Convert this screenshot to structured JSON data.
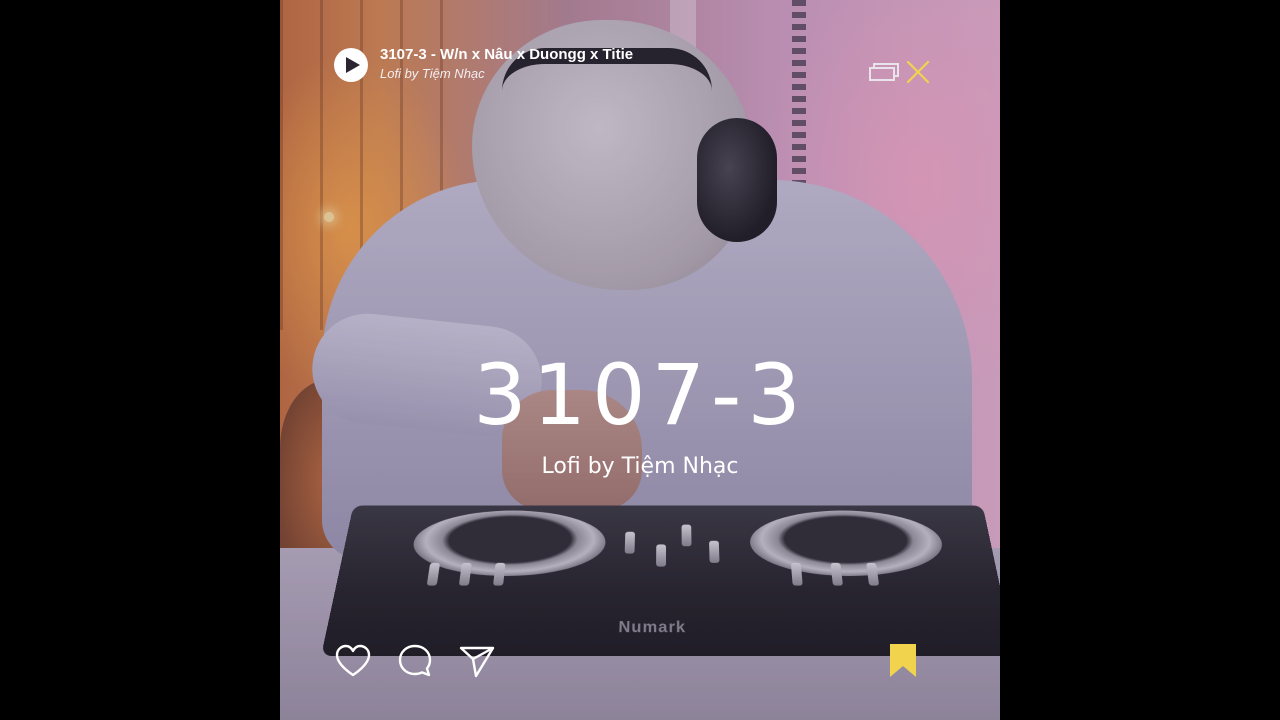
{
  "player": {
    "song_title": "3107-3 - W/n x Nâu x Duongg x Titie",
    "song_subtitle": "Lofi by Tiệm Nhạc"
  },
  "artwork": {
    "title": "3107-3",
    "subtitle": "Lofi by Tiệm Nhạc",
    "device_brand": "Numark"
  },
  "icons": {
    "play": "play-icon",
    "window": "window-stack-icon",
    "close": "close-icon",
    "like": "heart-icon",
    "comment": "comment-icon",
    "share": "send-icon",
    "save": "bookmark-icon"
  },
  "colors": {
    "accent_yellow": "#f2d34e",
    "text": "#ffffff"
  }
}
